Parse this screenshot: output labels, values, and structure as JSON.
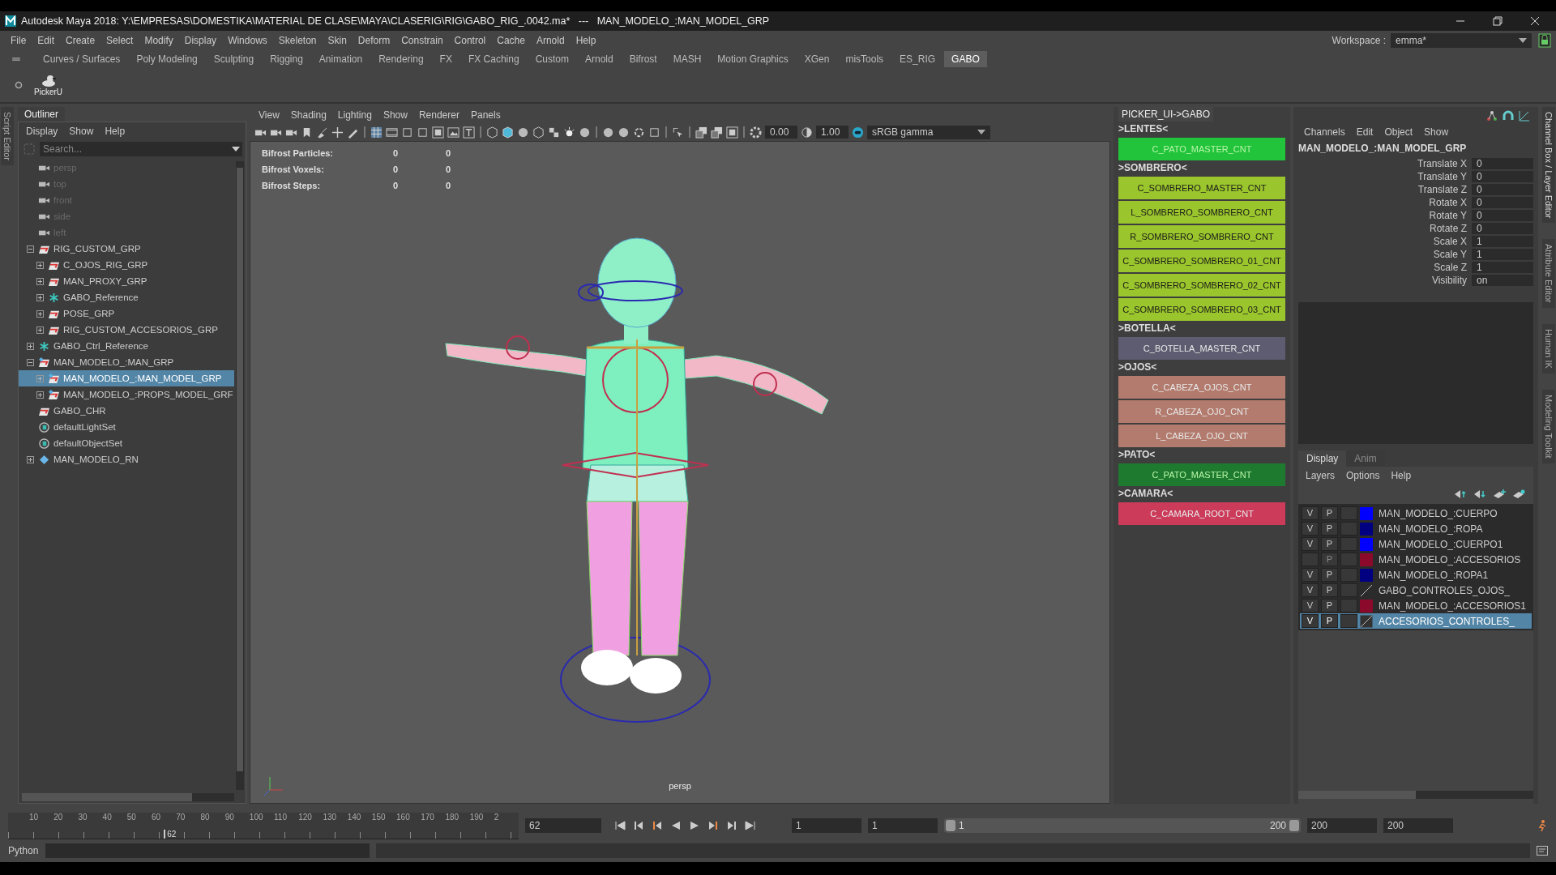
{
  "title_bar": {
    "title": "Autodesk Maya 2018: Y:\\EMPRESAS\\DOMESTIKA\\MATERIAL DE CLASE\\MAYA\\CLASERIG\\RIG\\GABO_RIG_.0042.ma*   ---   MAN_MODELO_:MAN_MODEL_GRP"
  },
  "menu_bar": {
    "items": [
      "File",
      "Edit",
      "Create",
      "Select",
      "Modify",
      "Display",
      "Windows",
      "Skeleton",
      "Skin",
      "Deform",
      "Constrain",
      "Control",
      "Cache",
      "Arnold",
      "Help"
    ],
    "workspace_label": "Workspace :",
    "workspace_value": "emma*"
  },
  "shelf": {
    "tabs": [
      {
        "label": "Curves / Surfaces",
        "selected": false
      },
      {
        "label": "Poly Modeling",
        "selected": false
      },
      {
        "label": "Sculpting",
        "selected": false
      },
      {
        "label": "Rigging",
        "selected": false
      },
      {
        "label": "Animation",
        "selected": false
      },
      {
        "label": "Rendering",
        "selected": false
      },
      {
        "label": "FX",
        "selected": false
      },
      {
        "label": "FX Caching",
        "selected": false
      },
      {
        "label": "Custom",
        "selected": false
      },
      {
        "label": "Arnold",
        "selected": false
      },
      {
        "label": "Bifrost",
        "selected": false
      },
      {
        "label": "MASH",
        "selected": false
      },
      {
        "label": "Motion Graphics",
        "selected": false
      },
      {
        "label": "XGen",
        "selected": false
      },
      {
        "label": "misTools",
        "selected": false
      },
      {
        "label": "ES_RIG",
        "selected": false
      },
      {
        "label": "GABO",
        "selected": true
      }
    ],
    "tools": [
      {
        "label": "PickerU"
      }
    ]
  },
  "left_side_tabs": [
    "Script Editor"
  ],
  "outliner": {
    "title": "Outliner",
    "menus": [
      "Display",
      "Show",
      "Help"
    ],
    "search_placeholder": "Search...",
    "tree": [
      {
        "label": "persp",
        "kind": "camera",
        "selected": false
      },
      {
        "label": "top",
        "kind": "camera",
        "selected": false
      },
      {
        "label": "front",
        "kind": "camera",
        "selected": false
      },
      {
        "label": "side",
        "kind": "camera",
        "selected": false
      },
      {
        "label": "left",
        "kind": "camera",
        "selected": false
      },
      {
        "label": "RIG_CUSTOM_GRP",
        "kind": "group",
        "selected": false,
        "expanded": true,
        "children": [
          {
            "label": "C_OJOS_RIG_GRP",
            "kind": "group",
            "selected": false,
            "expanded": false
          },
          {
            "label": "MAN_PROXY_GRP",
            "kind": "group",
            "selected": false,
            "expanded": false
          },
          {
            "label": "GABO_Reference",
            "kind": "reference",
            "selected": false,
            "expanded": false
          },
          {
            "label": "POSE_GRP",
            "kind": "group",
            "selected": false,
            "expanded": false
          },
          {
            "label": "RIG_CUSTOM_ACCESORIOS_GRP",
            "kind": "group",
            "selected": false,
            "expanded": false
          }
        ]
      },
      {
        "label": "GABO_Ctrl_Reference",
        "kind": "reference",
        "selected": false,
        "expanded": false
      },
      {
        "label": "MAN_MODELO_:MAN_GRP",
        "kind": "ref_group",
        "selected": false,
        "expanded": true,
        "children": [
          {
            "label": "MAN_MODELO_:MAN_MODEL_GRP",
            "kind": "ref_group",
            "selected": true,
            "expanded": false
          },
          {
            "label": "MAN_MODELO_:PROPS_MODEL_GRF",
            "kind": "ref_group",
            "selected": false,
            "expanded": false
          }
        ]
      },
      {
        "label": "GABO_CHR",
        "kind": "group",
        "selected": false
      },
      {
        "label": "defaultLightSet",
        "kind": "set",
        "selected": false
      },
      {
        "label": "defaultObjectSet",
        "kind": "set",
        "selected": false
      },
      {
        "label": "MAN_MODELO_RN",
        "kind": "rn",
        "selected": false,
        "expanded": false
      }
    ]
  },
  "viewport": {
    "menus": [
      "View",
      "Shading",
      "Lighting",
      "Show",
      "Renderer",
      "Panels"
    ],
    "exposure": "0.00",
    "gamma": "1.00",
    "color_space": "sRGB gamma",
    "hud": [
      {
        "label": "Bifrost Particles:",
        "values": [
          "0",
          "0"
        ]
      },
      {
        "label": "Bifrost Voxels:",
        "values": [
          "0",
          "0"
        ]
      },
      {
        "label": "Bifrost Steps:",
        "values": [
          "0",
          "0"
        ]
      }
    ],
    "camera": "persp"
  },
  "picker": {
    "title": "PICKER_UI->GABO",
    "sections": [
      {
        "title": ">LENTES<",
        "buttons": [
          {
            "label": "C_PATO_MASTER_CNT",
            "color": "#22c43c"
          }
        ]
      },
      {
        "title": ">SOMBRERO<",
        "buttons": [
          {
            "label": "C_SOMBRERO_MASTER_CNT",
            "color": "#9ac52c"
          },
          {
            "label": "L_SOMBRERO_SOMBRERO_CNT",
            "color": "#9ac52c"
          },
          {
            "label": "R_SOMBRERO_SOMBRERO_CNT",
            "color": "#9ac52c"
          },
          {
            "label": "C_SOMBRERO_SOMBRERO_01_CNT",
            "color": "#9ac52c"
          },
          {
            "label": "C_SOMBRERO_SOMBRERO_02_CNT",
            "color": "#9ac52c"
          },
          {
            "label": "C_SOMBRERO_SOMBRERO_03_CNT",
            "color": "#9ac52c"
          }
        ]
      },
      {
        "title": ">BOTELLA<",
        "buttons": [
          {
            "label": "C_BOTELLA_MASTER_CNT",
            "color": "#5e5c70"
          }
        ]
      },
      {
        "title": ">OJOS<",
        "buttons": [
          {
            "label": "C_CABEZA_OJOS_CNT",
            "color": "#b37b6d"
          },
          {
            "label": "R_CABEZA_OJO_CNT",
            "color": "#b37b6d"
          },
          {
            "label": "L_CABEZA_OJO_CNT",
            "color": "#b37b6d"
          }
        ]
      },
      {
        "title": ">PATO<",
        "buttons": [
          {
            "label": "C_PATO_MASTER_CNT",
            "color": "#1e7a2e"
          }
        ]
      },
      {
        "title": ">CAMARA<",
        "buttons": [
          {
            "label": "C_CAMARA_ROOT_CNT",
            "color": "#cc3b5a"
          }
        ]
      }
    ]
  },
  "channel_box": {
    "menus": [
      "Channels",
      "Edit",
      "Object",
      "Show"
    ],
    "object": "MAN_MODELO_:MAN_MODEL_GRP",
    "attributes": [
      {
        "name": "Translate X",
        "value": "0"
      },
      {
        "name": "Translate Y",
        "value": "0"
      },
      {
        "name": "Translate Z",
        "value": "0"
      },
      {
        "name": "Rotate X",
        "value": "0"
      },
      {
        "name": "Rotate Y",
        "value": "0"
      },
      {
        "name": "Rotate Z",
        "value": "0"
      },
      {
        "name": "Scale X",
        "value": "1"
      },
      {
        "name": "Scale Y",
        "value": "1"
      },
      {
        "name": "Scale Z",
        "value": "1"
      },
      {
        "name": "Visibility",
        "value": "on"
      }
    ]
  },
  "layer_editor": {
    "tabs": [
      {
        "label": "Display",
        "selected": true
      },
      {
        "label": "Anim",
        "selected": false
      }
    ],
    "menus": [
      "Layers",
      "Options",
      "Help"
    ],
    "layers": [
      {
        "v": "V",
        "p": "P",
        "playback": true,
        "name": "MAN_MODELO_:CUERPO",
        "kind": "swatch",
        "color": "#0000ff",
        "selected": false
      },
      {
        "v": "V",
        "p": "P",
        "playback": true,
        "name": "MAN_MODELO_:ROPA",
        "kind": "swatch",
        "color": "#000080",
        "selected": false
      },
      {
        "v": "V",
        "p": "P",
        "playback": true,
        "name": "MAN_MODELO_:CUERPO1",
        "kind": "swatch",
        "color": "#0000ff",
        "selected": false
      },
      {
        "p": "P",
        "playback": false,
        "name": "MAN_MODELO_:ACCESORIOS",
        "kind": "swatch",
        "color": "#8b0a2c",
        "selected": false
      },
      {
        "v": "V",
        "p": "P",
        "playback": true,
        "name": "MAN_MODELO_:ROPA1",
        "kind": "swatch",
        "color": "#000080",
        "selected": false
      },
      {
        "v": "V",
        "p": "P",
        "playback": true,
        "name": "GABO_CONTROLES_OJOS_",
        "kind": "none",
        "selected": false
      },
      {
        "v": "V",
        "p": "P",
        "playback": true,
        "name": "MAN_MODELO_:ACCESORIOS1",
        "kind": "swatch",
        "color": "#8b0a2c",
        "selected": false
      },
      {
        "v": "V",
        "p": "P",
        "playback": true,
        "name": "ACCESORIOS_CONTROLES_",
        "kind": "none",
        "selected": true
      }
    ]
  },
  "right_side_tabs": [
    "Channel Box / Layer Editor",
    "Attribute Editor",
    "Human IK",
    "Modeling Toolkit"
  ],
  "time_slider": {
    "ticks": [
      "10",
      "20",
      "30",
      "40",
      "50",
      "60",
      "70",
      "80",
      "90",
      "100",
      "110",
      "120",
      "130",
      "140",
      "150",
      "160",
      "170",
      "180",
      "190",
      "2"
    ],
    "current_label": "62",
    "level": 0.305,
    "current_frame": "62"
  },
  "range": {
    "start": "1",
    "playback_start": "1",
    "slider_start": "1",
    "slider_end": "200",
    "level": 1,
    "playback_end": "200",
    "end": "200"
  },
  "command_line": {
    "language": "Python"
  }
}
